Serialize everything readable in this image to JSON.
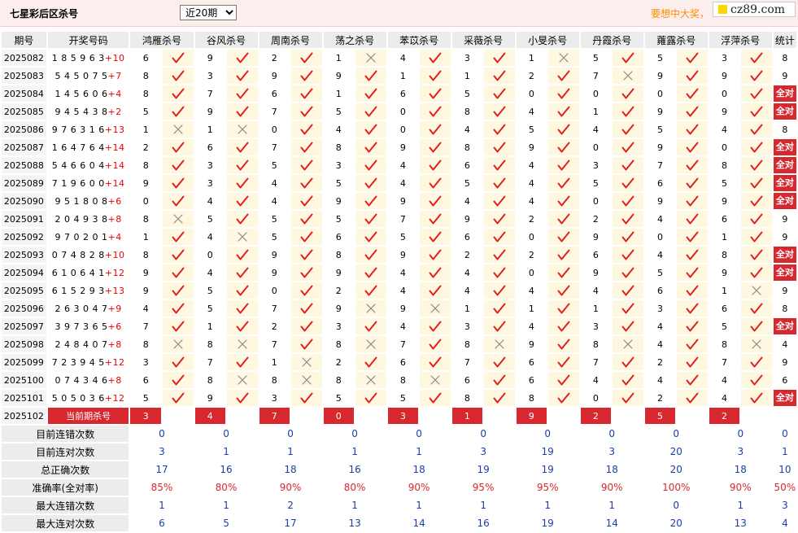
{
  "page": {
    "title": "七星彩后区杀号",
    "period_select": {
      "selected": "近20期",
      "options": [
        "近20期"
      ]
    },
    "slogan": "要想中大奖，",
    "logo_text": "cz89.com"
  },
  "table": {
    "headers": [
      "期号",
      "开奖号码",
      "鸿雁杀号",
      "谷风杀号",
      "周南杀号",
      "荡之杀号",
      "苯苡杀号",
      "采薇杀号",
      "小旻杀号",
      "丹霞杀号",
      "蕹露杀号",
      "浮萍杀号",
      "统计"
    ],
    "rows": [
      {
        "period": "2025082",
        "digits": "185963",
        "special": "+10",
        "kills": [
          [
            "6",
            1
          ],
          [
            "9",
            1
          ],
          [
            "2",
            1
          ],
          [
            "1",
            0
          ],
          [
            "4",
            1
          ],
          [
            "3",
            1
          ],
          [
            "1",
            0
          ],
          [
            "5",
            1
          ],
          [
            "5",
            1
          ],
          [
            "3",
            1
          ]
        ],
        "stat": "8"
      },
      {
        "period": "2025083",
        "digits": "545075",
        "special": "+7",
        "kills": [
          [
            "8",
            1
          ],
          [
            "3",
            1
          ],
          [
            "9",
            1
          ],
          [
            "9",
            1
          ],
          [
            "1",
            1
          ],
          [
            "1",
            1
          ],
          [
            "2",
            1
          ],
          [
            "7",
            0
          ],
          [
            "9",
            1
          ],
          [
            "9",
            1
          ]
        ],
        "stat": "9"
      },
      {
        "period": "2025084",
        "digits": "145606",
        "special": "+4",
        "kills": [
          [
            "8",
            1
          ],
          [
            "7",
            1
          ],
          [
            "6",
            1
          ],
          [
            "1",
            1
          ],
          [
            "6",
            1
          ],
          [
            "5",
            1
          ],
          [
            "0",
            1
          ],
          [
            "0",
            1
          ],
          [
            "0",
            1
          ],
          [
            "0",
            1
          ]
        ],
        "stat": "全对"
      },
      {
        "period": "2025085",
        "digits": "945438",
        "special": "+2",
        "kills": [
          [
            "5",
            1
          ],
          [
            "9",
            1
          ],
          [
            "7",
            1
          ],
          [
            "5",
            1
          ],
          [
            "0",
            1
          ],
          [
            "8",
            1
          ],
          [
            "4",
            1
          ],
          [
            "1",
            1
          ],
          [
            "9",
            1
          ],
          [
            "9",
            1
          ]
        ],
        "stat": "全对"
      },
      {
        "period": "2025086",
        "digits": "976316",
        "special": "+13",
        "kills": [
          [
            "1",
            0
          ],
          [
            "1",
            0
          ],
          [
            "0",
            1
          ],
          [
            "4",
            1
          ],
          [
            "0",
            1
          ],
          [
            "4",
            1
          ],
          [
            "5",
            1
          ],
          [
            "4",
            1
          ],
          [
            "5",
            1
          ],
          [
            "4",
            1
          ]
        ],
        "stat": "8"
      },
      {
        "period": "2025087",
        "digits": "164764",
        "special": "+14",
        "kills": [
          [
            "2",
            1
          ],
          [
            "6",
            1
          ],
          [
            "7",
            1
          ],
          [
            "8",
            1
          ],
          [
            "9",
            1
          ],
          [
            "8",
            1
          ],
          [
            "9",
            1
          ],
          [
            "0",
            1
          ],
          [
            "9",
            1
          ],
          [
            "0",
            1
          ]
        ],
        "stat": "全对"
      },
      {
        "period": "2025088",
        "digits": "546604",
        "special": "+14",
        "kills": [
          [
            "8",
            1
          ],
          [
            "3",
            1
          ],
          [
            "5",
            1
          ],
          [
            "3",
            1
          ],
          [
            "4",
            1
          ],
          [
            "6",
            1
          ],
          [
            "4",
            1
          ],
          [
            "3",
            1
          ],
          [
            "7",
            1
          ],
          [
            "8",
            1
          ]
        ],
        "stat": "全对"
      },
      {
        "period": "2025089",
        "digits": "719600",
        "special": "+14",
        "kills": [
          [
            "9",
            1
          ],
          [
            "3",
            1
          ],
          [
            "4",
            1
          ],
          [
            "5",
            1
          ],
          [
            "4",
            1
          ],
          [
            "5",
            1
          ],
          [
            "4",
            1
          ],
          [
            "5",
            1
          ],
          [
            "6",
            1
          ],
          [
            "5",
            1
          ]
        ],
        "stat": "全对"
      },
      {
        "period": "2025090",
        "digits": "951808",
        "special": "+6",
        "kills": [
          [
            "0",
            1
          ],
          [
            "4",
            1
          ],
          [
            "4",
            1
          ],
          [
            "9",
            1
          ],
          [
            "9",
            1
          ],
          [
            "4",
            1
          ],
          [
            "4",
            1
          ],
          [
            "0",
            1
          ],
          [
            "9",
            1
          ],
          [
            "9",
            1
          ]
        ],
        "stat": "全对"
      },
      {
        "period": "2025091",
        "digits": "204938",
        "special": "+8",
        "kills": [
          [
            "8",
            0
          ],
          [
            "5",
            1
          ],
          [
            "5",
            1
          ],
          [
            "5",
            1
          ],
          [
            "7",
            1
          ],
          [
            "9",
            1
          ],
          [
            "2",
            1
          ],
          [
            "2",
            1
          ],
          [
            "4",
            1
          ],
          [
            "6",
            1
          ]
        ],
        "stat": "9"
      },
      {
        "period": "2025092",
        "digits": "970201",
        "special": "+4",
        "kills": [
          [
            "1",
            1
          ],
          [
            "4",
            0
          ],
          [
            "5",
            1
          ],
          [
            "6",
            1
          ],
          [
            "5",
            1
          ],
          [
            "6",
            1
          ],
          [
            "0",
            1
          ],
          [
            "9",
            1
          ],
          [
            "0",
            1
          ],
          [
            "1",
            1
          ]
        ],
        "stat": "9"
      },
      {
        "period": "2025093",
        "digits": "074828",
        "special": "+10",
        "kills": [
          [
            "8",
            1
          ],
          [
            "0",
            1
          ],
          [
            "9",
            1
          ],
          [
            "8",
            1
          ],
          [
            "9",
            1
          ],
          [
            "2",
            1
          ],
          [
            "2",
            1
          ],
          [
            "6",
            1
          ],
          [
            "4",
            1
          ],
          [
            "8",
            1
          ]
        ],
        "stat": "全对"
      },
      {
        "period": "2025094",
        "digits": "610641",
        "special": "+12",
        "kills": [
          [
            "9",
            1
          ],
          [
            "4",
            1
          ],
          [
            "9",
            1
          ],
          [
            "9",
            1
          ],
          [
            "4",
            1
          ],
          [
            "4",
            1
          ],
          [
            "0",
            1
          ],
          [
            "9",
            1
          ],
          [
            "5",
            1
          ],
          [
            "9",
            1
          ]
        ],
        "stat": "全对"
      },
      {
        "period": "2025095",
        "digits": "615293",
        "special": "+13",
        "kills": [
          [
            "9",
            1
          ],
          [
            "5",
            1
          ],
          [
            "0",
            1
          ],
          [
            "2",
            1
          ],
          [
            "4",
            1
          ],
          [
            "4",
            1
          ],
          [
            "4",
            1
          ],
          [
            "4",
            1
          ],
          [
            "6",
            1
          ],
          [
            "1",
            0
          ]
        ],
        "stat": "9"
      },
      {
        "period": "2025096",
        "digits": "263047",
        "special": "+9",
        "kills": [
          [
            "4",
            1
          ],
          [
            "5",
            1
          ],
          [
            "7",
            1
          ],
          [
            "9",
            0
          ],
          [
            "9",
            0
          ],
          [
            "1",
            1
          ],
          [
            "1",
            1
          ],
          [
            "1",
            1
          ],
          [
            "3",
            1
          ],
          [
            "6",
            1
          ]
        ],
        "stat": "8"
      },
      {
        "period": "2025097",
        "digits": "397365",
        "special": "+6",
        "kills": [
          [
            "7",
            1
          ],
          [
            "1",
            1
          ],
          [
            "2",
            1
          ],
          [
            "3",
            1
          ],
          [
            "4",
            1
          ],
          [
            "3",
            1
          ],
          [
            "4",
            1
          ],
          [
            "3",
            1
          ],
          [
            "4",
            1
          ],
          [
            "5",
            1
          ]
        ],
        "stat": "全对"
      },
      {
        "period": "2025098",
        "digits": "248407",
        "special": "+8",
        "kills": [
          [
            "8",
            0
          ],
          [
            "8",
            0
          ],
          [
            "7",
            1
          ],
          [
            "8",
            0
          ],
          [
            "7",
            1
          ],
          [
            "8",
            0
          ],
          [
            "9",
            1
          ],
          [
            "8",
            0
          ],
          [
            "4",
            1
          ],
          [
            "8",
            0
          ]
        ],
        "stat": "4"
      },
      {
        "period": "2025099",
        "digits": "723945",
        "special": "+12",
        "kills": [
          [
            "3",
            1
          ],
          [
            "7",
            1
          ],
          [
            "1",
            0
          ],
          [
            "2",
            1
          ],
          [
            "6",
            1
          ],
          [
            "7",
            1
          ],
          [
            "6",
            1
          ],
          [
            "7",
            1
          ],
          [
            "2",
            1
          ],
          [
            "7",
            1
          ]
        ],
        "stat": "9"
      },
      {
        "period": "2025100",
        "digits": "074346",
        "special": "+8",
        "kills": [
          [
            "6",
            1
          ],
          [
            "8",
            0
          ],
          [
            "8",
            0
          ],
          [
            "8",
            0
          ],
          [
            "8",
            0
          ],
          [
            "6",
            1
          ],
          [
            "6",
            1
          ],
          [
            "4",
            1
          ],
          [
            "4",
            1
          ],
          [
            "4",
            1
          ]
        ],
        "stat": "6"
      },
      {
        "period": "2025101",
        "digits": "505036",
        "special": "+12",
        "kills": [
          [
            "5",
            1
          ],
          [
            "9",
            1
          ],
          [
            "3",
            1
          ],
          [
            "5",
            1
          ],
          [
            "5",
            1
          ],
          [
            "8",
            1
          ],
          [
            "8",
            1
          ],
          [
            "0",
            1
          ],
          [
            "2",
            1
          ],
          [
            "4",
            1
          ]
        ],
        "stat": "全对"
      }
    ],
    "current": {
      "period": "2025102",
      "label": "当前期杀号",
      "kills": [
        "3",
        "4",
        "7",
        "0",
        "3",
        "1",
        "9",
        "2",
        "5",
        "2"
      ]
    },
    "summary": [
      {
        "label": "目前连错次数",
        "values": [
          "0",
          "0",
          "0",
          "0",
          "0",
          "0",
          "0",
          "0",
          "0",
          "0",
          "0"
        ],
        "red": false
      },
      {
        "label": "目前连对次数",
        "values": [
          "3",
          "1",
          "1",
          "1",
          "1",
          "3",
          "19",
          "3",
          "20",
          "3",
          "1"
        ],
        "red": false
      },
      {
        "label": "总正确次数",
        "values": [
          "17",
          "16",
          "18",
          "16",
          "18",
          "19",
          "19",
          "18",
          "20",
          "18",
          "10"
        ],
        "red": false
      },
      {
        "label": "准确率(全对率)",
        "values": [
          "85%",
          "80%",
          "90%",
          "80%",
          "90%",
          "95%",
          "95%",
          "90%",
          "100%",
          "90%",
          "50%"
        ],
        "red": true
      },
      {
        "label": "最大连错次数",
        "values": [
          "1",
          "1",
          "2",
          "1",
          "1",
          "1",
          "1",
          "1",
          "0",
          "1",
          "3"
        ],
        "red": false
      },
      {
        "label": "最大连对次数",
        "values": [
          "6",
          "5",
          "17",
          "13",
          "14",
          "16",
          "19",
          "14",
          "20",
          "13",
          "4"
        ],
        "red": false
      }
    ]
  },
  "colors": {
    "accent_red": "#d7282f",
    "value_blue": "#1b3fa6",
    "slogan_orange": "#ff8a00",
    "topbar_pink": "#fdeeee"
  }
}
